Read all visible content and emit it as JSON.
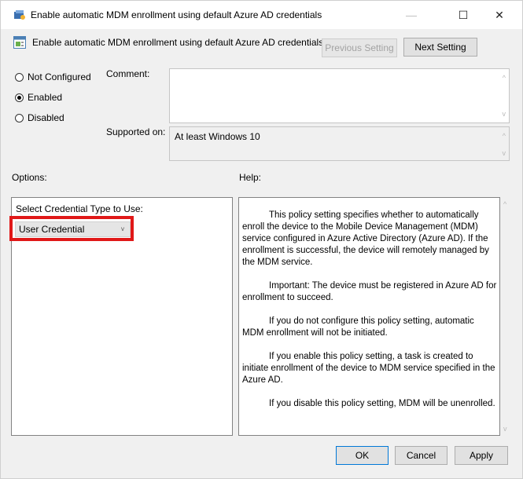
{
  "window": {
    "title": "Enable automatic MDM enrollment using default Azure AD credentials",
    "minimize_glyph": "—",
    "maximize_glyph": "☐",
    "close_glyph": "✕"
  },
  "header": {
    "policy_title": "Enable automatic MDM enrollment using default Azure AD credentials",
    "previous_label": "Previous Setting",
    "next_label": "Next Setting"
  },
  "state": {
    "options": [
      {
        "label": "Not Configured",
        "checked": false
      },
      {
        "label": "Enabled",
        "checked": true
      },
      {
        "label": "Disabled",
        "checked": false
      }
    ]
  },
  "comment": {
    "label": "Comment:",
    "value": ""
  },
  "supported": {
    "label": "Supported on:",
    "value": "At least Windows 10"
  },
  "options_section": {
    "label": "Options:",
    "credential_label": "Select Credential Type to Use:",
    "credential_value": "User Credential"
  },
  "help_section": {
    "label": "Help:",
    "paragraphs": [
      "This policy setting specifies whether to automatically enroll the device to the Mobile Device Management (MDM) service configured in Azure Active Directory (Azure AD). If the enrollment is successful, the device will remotely managed by the MDM service.",
      "Important: The device must be registered in Azure AD for enrollment to succeed.",
      "If you do not configure this policy setting, automatic MDM enrollment will not be initiated.",
      "If you enable this policy setting, a task is created to initiate enrollment of the device to MDM service specified in the Azure AD.",
      "If you disable this policy setting, MDM will be unenrolled."
    ]
  },
  "footer": {
    "ok_label": "OK",
    "cancel_label": "Cancel",
    "apply_label": "Apply"
  },
  "icons": {
    "title_icon": "policy-tool-icon",
    "policy_icon": "policy-setting-icon",
    "accent": "#0078d7",
    "highlight": "#e01818"
  }
}
